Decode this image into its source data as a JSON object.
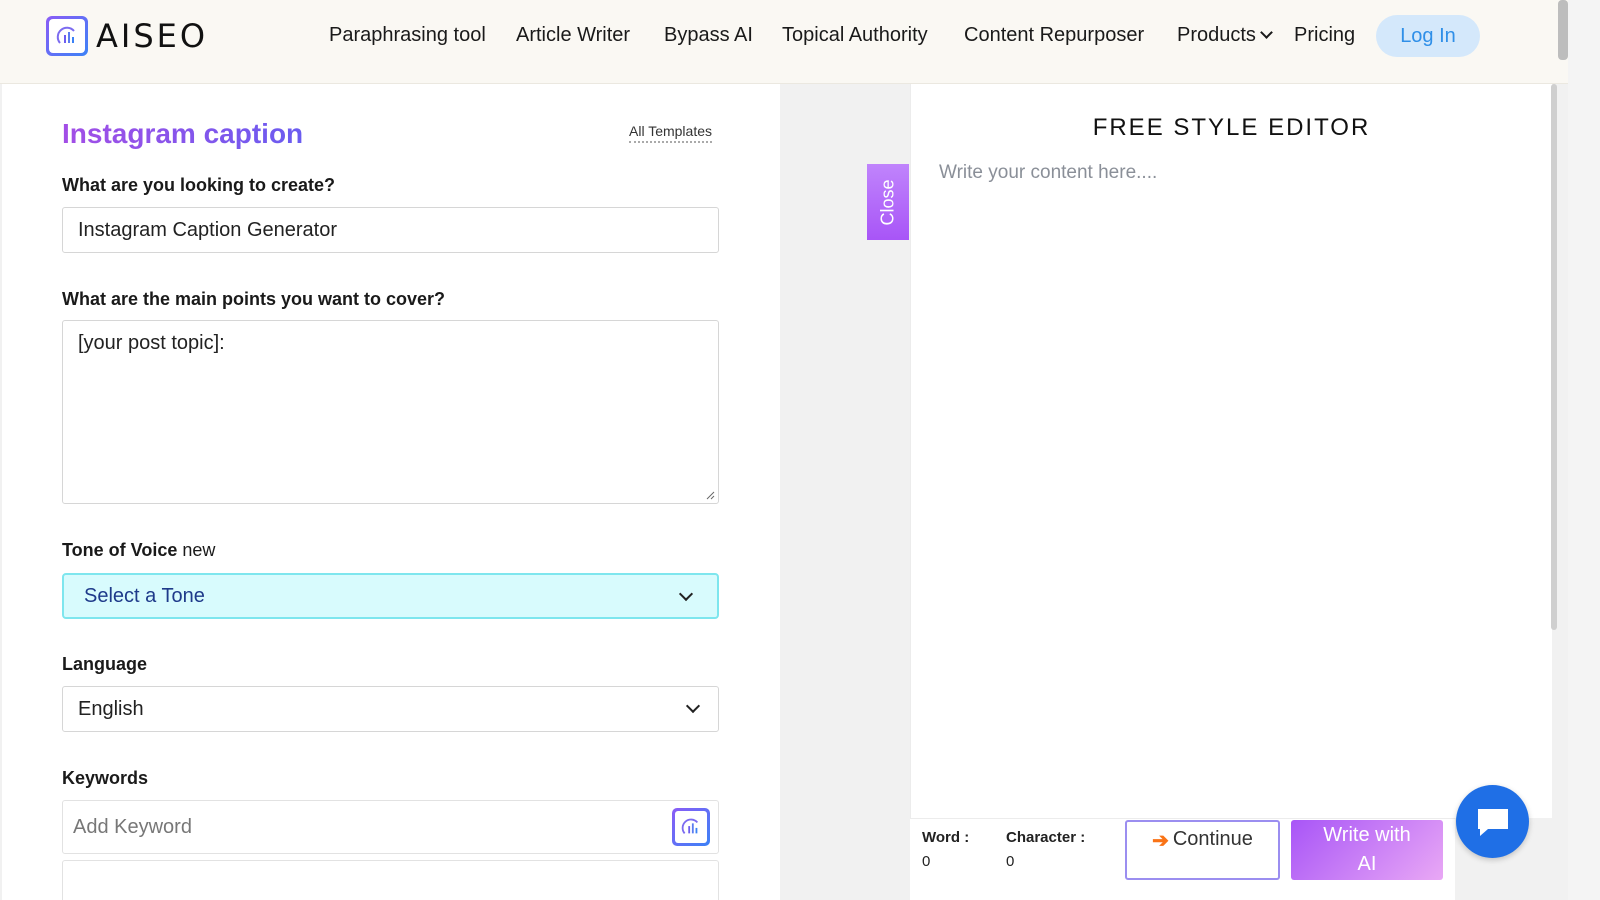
{
  "brand": {
    "name": "AISEO",
    "logo_icon": "bar-chart-logo-icon"
  },
  "nav": {
    "items": [
      "Paraphrasing tool",
      "Article Writer",
      "Bypass AI",
      "Topical Authority",
      "Content Repurposer",
      "Products",
      "Pricing"
    ],
    "login_label": "Log In"
  },
  "form": {
    "title": "Instagram caption",
    "all_templates": "All Templates",
    "q_create": "What are you looking to create?",
    "create_value": "Instagram Caption Generator",
    "q_points": "What are the main points you want to cover?",
    "points_value": "[your post topic]:",
    "tone_label": "Tone of Voice",
    "tone_badge": "new",
    "tone_value": "Select a Tone",
    "language_label": "Language",
    "language_value": "English",
    "keywords_label": "Keywords",
    "keyword_placeholder": "Add Keyword"
  },
  "editor": {
    "close_label": "Close",
    "title": "FREE STYLE EDITOR",
    "placeholder": "Write your content here....",
    "word_label": "Word :",
    "word_count": "0",
    "char_label": "Character :",
    "char_count": "0",
    "continue_label": "Continue",
    "write_ai_line1": "Write with",
    "write_ai_line2": "AI"
  },
  "colors": {
    "accent": "#a855f7",
    "login_bg": "#d4e8fb",
    "chat": "#1f6fe6",
    "tone_bg": "#d8fbfd"
  }
}
